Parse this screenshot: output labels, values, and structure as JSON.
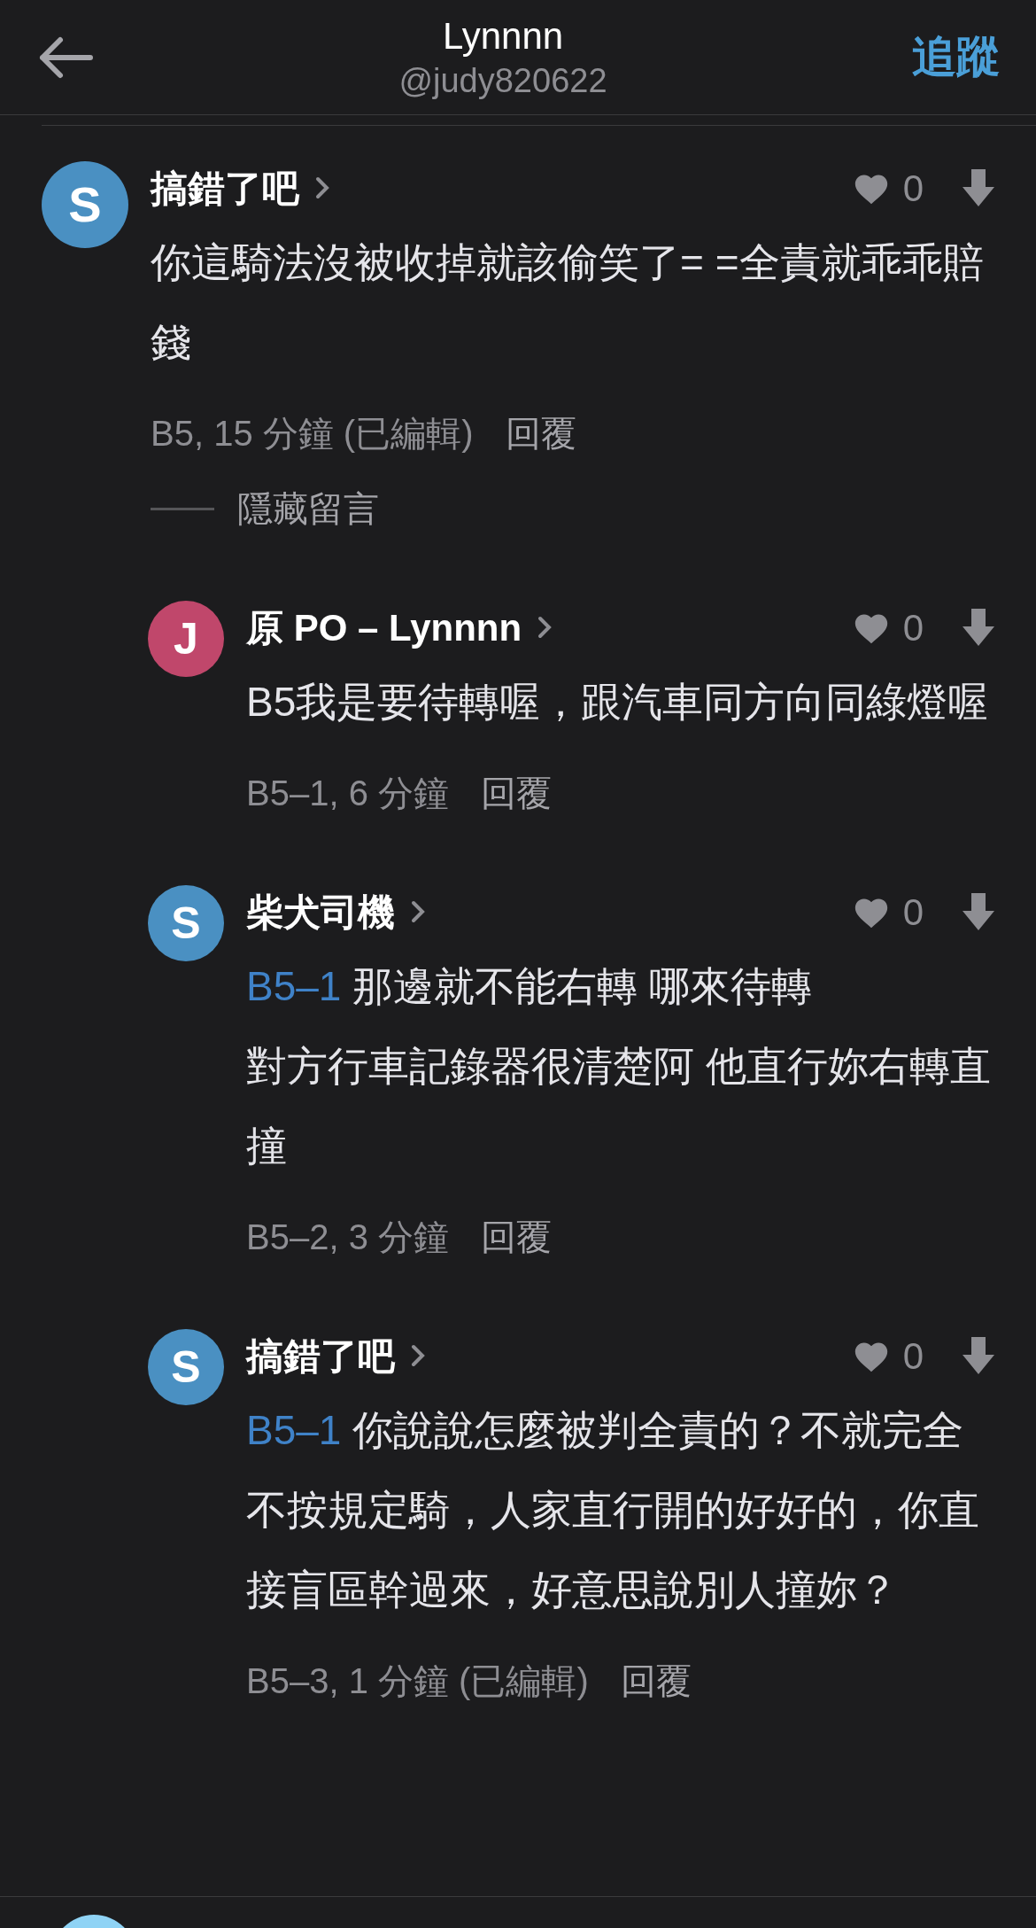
{
  "header": {
    "title": "Lynnnn",
    "handle": "@judy820622",
    "follow": "追蹤"
  },
  "comment": {
    "avatar": "S",
    "color": "#4a90c2",
    "author": "搞錯了吧",
    "likes": "0",
    "body": "你這騎法沒被收掉就該偷笑了= =全責就乖乖賠錢",
    "meta": "B5, 15 分鐘 (已編輯)",
    "reply": "回覆",
    "hide": "隱藏留言",
    "children": [
      {
        "avatar": "J",
        "color": "#c0476b",
        "author": "原 PO – Lynnnn",
        "likes": "0",
        "body": "B5我是要待轉喔，跟汽車同方向同綠燈喔",
        "meta": "B5–1, 6 分鐘",
        "reply": "回覆"
      },
      {
        "avatar": "S",
        "color": "#4a90c2",
        "author": "柴犬司機",
        "likes": "0",
        "reply_to": "B5–1",
        "body": "那邊就不能右轉 哪來待轉",
        "body_2": "對方行車記錄器很清楚阿 他直行妳右轉直撞",
        "meta": "B5–2, 3 分鐘",
        "reply": "回覆"
      },
      {
        "avatar": "S",
        "color": "#4a90c2",
        "author": "搞錯了吧",
        "likes": "0",
        "reply_to": "B5–1",
        "body": "你說說怎麼被判全責的？不就完全不按規定騎，人家直行開的好好的，你直接盲區幹過來，好意思說別人撞妳？",
        "meta": "B5–3, 1 分鐘 (已編輯)",
        "reply": "回覆"
      }
    ]
  }
}
